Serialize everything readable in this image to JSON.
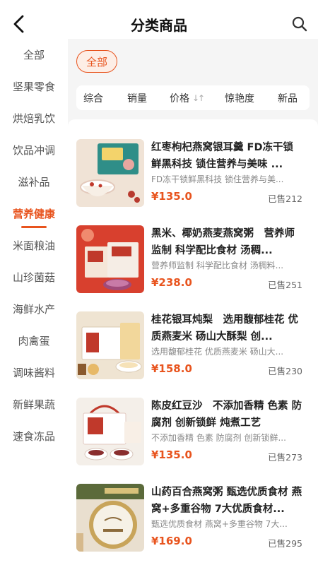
{
  "header": {
    "title": "分类商品",
    "back_icon": "chevron-left-icon",
    "search_icon": "search-icon"
  },
  "sidebar": {
    "items": [
      {
        "label": "全部"
      },
      {
        "label": "坚果零食"
      },
      {
        "label": "烘焙乳饮"
      },
      {
        "label": "饮品冲调"
      },
      {
        "label": "滋补品"
      },
      {
        "label": "营养健康",
        "active": true
      },
      {
        "label": "米面粮油"
      },
      {
        "label": "山珍菌菇"
      },
      {
        "label": "海鲜水产"
      },
      {
        "label": "肉禽蛋"
      },
      {
        "label": "调味酱料"
      },
      {
        "label": "新鲜果蔬"
      },
      {
        "label": "速食冻品"
      }
    ]
  },
  "filter": {
    "chip_label": "全部"
  },
  "sort": {
    "items": [
      {
        "label": "综合"
      },
      {
        "label": "销量"
      },
      {
        "label": "价格",
        "arrows": "↓↑"
      },
      {
        "label": "惊艳度"
      },
      {
        "label": "新品"
      }
    ]
  },
  "products": [
    {
      "title": "红枣枸杞燕窝银耳羹 FD冻干锁鲜黑科技 锁住营养与美味 ...",
      "subtitle": "FD冻干锁鲜黑科技 锁住营养与美...",
      "price": "¥135.0",
      "sold": "已售212"
    },
    {
      "title": "黑米、椰奶燕麦燕窝粥　营养师监制 科学配比食材 汤稠...",
      "subtitle": "营养师监制 科学配比食材 汤稠料...",
      "price": "¥238.0",
      "sold": "已售251"
    },
    {
      "title": "桂花银耳炖梨　选用馥郁桂花 优质燕麦米 砀山大酥梨 创...",
      "subtitle": "选用馥郁桂花 优质燕麦米 砀山大...",
      "price": "¥158.0",
      "sold": "已售230"
    },
    {
      "title": "陈皮红豆沙　不添加香精 色素 防腐剂 创新锁鲜 炖煮工艺",
      "subtitle": "不添加香精 色素 防腐剂 创新锁鲜...",
      "price": "¥135.0",
      "sold": "已售273"
    },
    {
      "title": "山药百合燕窝粥 甄选优质食材 燕窝+多重谷物 7大优质食材...",
      "subtitle": "甄选优质食材 燕窝+多重谷物 7大...",
      "price": "¥169.0",
      "sold": "已售295"
    }
  ],
  "colors": {
    "accent": "#e8541e",
    "background": "#f5f5f5"
  }
}
